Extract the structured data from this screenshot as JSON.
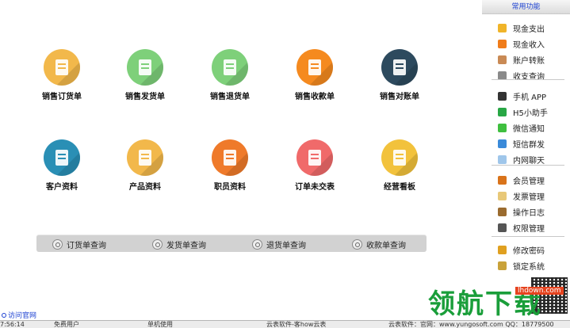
{
  "tiles": [
    {
      "label": "销售订货单",
      "icon": "order-icon",
      "color": "#f2b84b"
    },
    {
      "label": "销售发货单",
      "icon": "truck-icon",
      "color": "#7ed07a"
    },
    {
      "label": "销售退货单",
      "icon": "return-icon",
      "color": "#7ed07a"
    },
    {
      "label": "销售收款单",
      "icon": "yen-icon",
      "color": "#f58a1f"
    },
    {
      "label": "销售对账单",
      "icon": "clipboard-icon",
      "color": "#2d4a5e"
    },
    {
      "label": "客户资料",
      "icon": "customer-icon",
      "color": "#2a8fb5"
    },
    {
      "label": "产品资料",
      "icon": "boxes-icon",
      "color": "#f2b84b"
    },
    {
      "label": "职员资料",
      "icon": "staff-icon",
      "color": "#ef7a2a"
    },
    {
      "label": "订单未交表",
      "icon": "stopwatch-icon",
      "color": "#f06a6a"
    },
    {
      "label": "经营看板",
      "icon": "chart-board-icon",
      "color": "#f2c23c"
    }
  ],
  "queries": [
    "订货单查询",
    "发货单查询",
    "退货单查询",
    "收款单查询"
  ],
  "sidebar": {
    "title": "常用功能",
    "items": [
      {
        "label": "现金支出",
        "icon": "cash-out-icon",
        "color": "#f0b429"
      },
      {
        "label": "现金收入",
        "icon": "cash-in-icon",
        "color": "#f07c1a"
      },
      {
        "label": "账户转账",
        "icon": "transfer-icon",
        "color": "#c98a55"
      },
      {
        "label": "收支查询",
        "icon": "ledger-query-icon",
        "color": "#8a8a8a"
      },
      {
        "label": "手机 APP",
        "icon": "phone-icon",
        "color": "#333333"
      },
      {
        "label": "H5小助手",
        "icon": "check-circle-icon",
        "color": "#28a745"
      },
      {
        "label": "微信通知",
        "icon": "wechat-icon",
        "color": "#3fbf3f"
      },
      {
        "label": "短信群发",
        "icon": "sms-icon",
        "color": "#3a8ad9"
      },
      {
        "label": "内网聊天",
        "icon": "chat-bubble-icon",
        "color": "#9fc6ea"
      },
      {
        "label": "会员管理",
        "icon": "member-icon",
        "color": "#d9731a"
      },
      {
        "label": "发票管理",
        "icon": "invoice-icon",
        "color": "#e8c878"
      },
      {
        "label": "操作日志",
        "icon": "log-icon",
        "color": "#9a6b2f"
      },
      {
        "label": "权限管理",
        "icon": "monitor-icon",
        "color": "#555555"
      },
      {
        "label": "修改密码",
        "icon": "key-icon",
        "color": "#e0a020"
      },
      {
        "label": "锁定系统",
        "icon": "lock-icon",
        "color": "#c9a23a"
      }
    ]
  },
  "footer": {
    "visit_link": "访问官网",
    "time": "7:56:14",
    "user": "免费用户",
    "mode": "单机使用",
    "product": "云表软件-客how云表",
    "contact": "云表软件：官网：www.yungosoft.com  QQ：18779500"
  },
  "watermark": {
    "text": "领航下载",
    "url": "lhdown.com"
  }
}
